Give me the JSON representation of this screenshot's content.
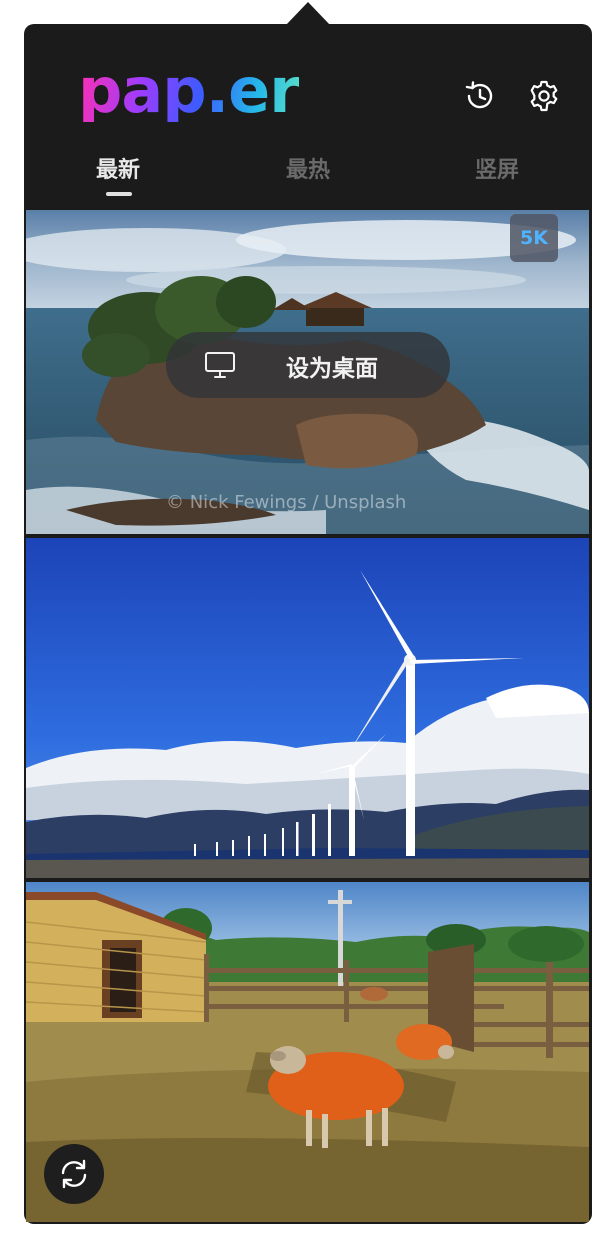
{
  "app": {
    "logo_text": "pap.er",
    "brand_colors": [
      "#ff2fb0",
      "#9b3dff",
      "#3d5bff",
      "#25b8e8"
    ]
  },
  "toolbar": {
    "history_icon": "history-clock-icon",
    "settings_icon": "gear-icon"
  },
  "tabs": [
    {
      "label": "最新",
      "active": true
    },
    {
      "label": "最热",
      "active": false
    },
    {
      "label": "竖屏",
      "active": false
    }
  ],
  "wallpapers": [
    {
      "badge": "5K",
      "action_label": "设为桌面",
      "action_icon": "monitor-icon",
      "credit": "© Nick Fewings / Unsplash"
    },
    {},
    {}
  ],
  "refresh_icon": "refresh-icon",
  "colors": {
    "panel_bg": "#1b1b1b",
    "badge_text": "#4fb3ff",
    "tab_active": "#e8e8e8",
    "tab_inactive": "#6a6a6a"
  }
}
